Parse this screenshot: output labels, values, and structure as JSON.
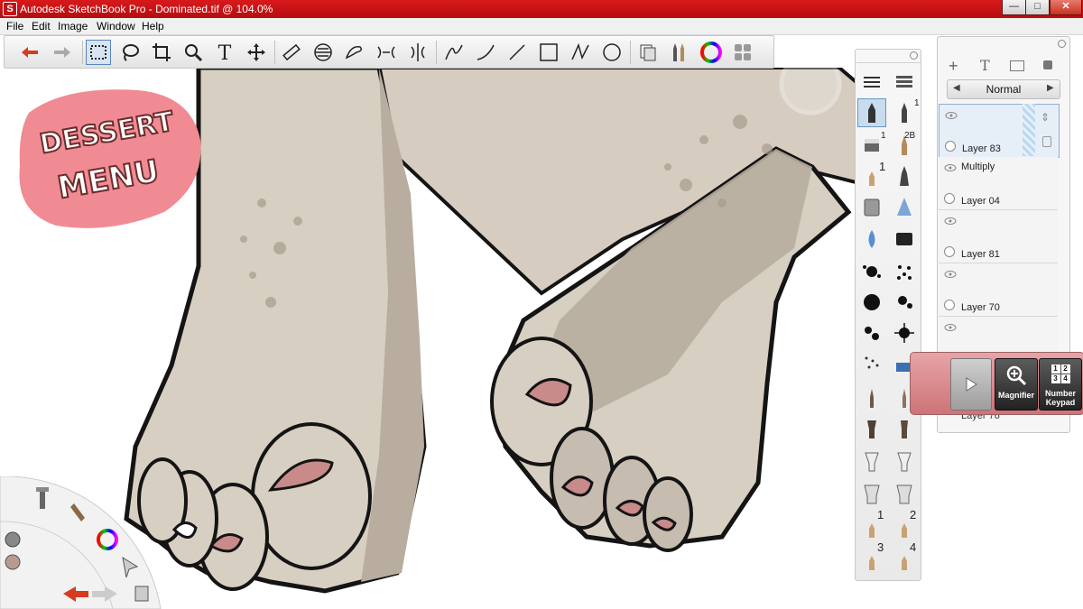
{
  "window": {
    "title": "Autodesk SketchBook Pro - Dominated.tif @ 104.0%",
    "app_icon": "S",
    "controls": {
      "minimize": "—",
      "maximize": "□",
      "close": "✕"
    }
  },
  "menu": [
    "File",
    "Edit",
    "Image",
    "Window",
    "Help"
  ],
  "toolbar": {
    "tools": [
      "undo-icon",
      "redo-icon",
      "rect-select-icon",
      "lasso-icon",
      "crop-icon",
      "zoom-icon",
      "text-icon",
      "move-icon",
      "ruler-icon",
      "ellipse-guide-icon",
      "french-curve-icon",
      "symmetry-x-icon",
      "symmetry-y-icon",
      "line-stroke-icon",
      "curve-icon",
      "straight-line-icon",
      "rectangle-icon",
      "polyline-icon",
      "ellipse-icon",
      "copic-icon",
      "brush-palette-icon",
      "color-wheel-icon",
      "layer-editor-icon"
    ]
  },
  "artwork": {
    "logo_text": [
      "DESSERT",
      "MENU"
    ],
    "colors": {
      "skin": "#d7cfc2",
      "skin_shadow": "#b8ad9f",
      "nail": "#c98a8a",
      "logo_pink": "#f08b94",
      "outline": "#141414"
    }
  },
  "brush_palette": {
    "numbers": {
      "pencil_size": "1",
      "eraser_size": "1",
      "marker_size": "2B",
      "left_one": "1",
      "set1": "1",
      "set2": "2",
      "set3": "3",
      "set4": "4"
    }
  },
  "layers": {
    "blend_mode": "Normal",
    "items": [
      {
        "name": "Layer 83",
        "mode": "",
        "selected": true
      },
      {
        "name": "Layer 04",
        "mode": "Multiply",
        "selected": false
      },
      {
        "name": "Layer 81",
        "mode": "",
        "selected": false
      },
      {
        "name": "Layer 70",
        "mode": "",
        "selected": false
      },
      {
        "name": "Layer 76",
        "mode": "",
        "selected": false
      }
    ]
  },
  "float_controls": {
    "magnifier_label": "Magnifier",
    "keypad_label_1": "Number",
    "keypad_label_2": "Keypad",
    "keypad_digits": [
      "1",
      "2",
      "3",
      "4"
    ]
  }
}
